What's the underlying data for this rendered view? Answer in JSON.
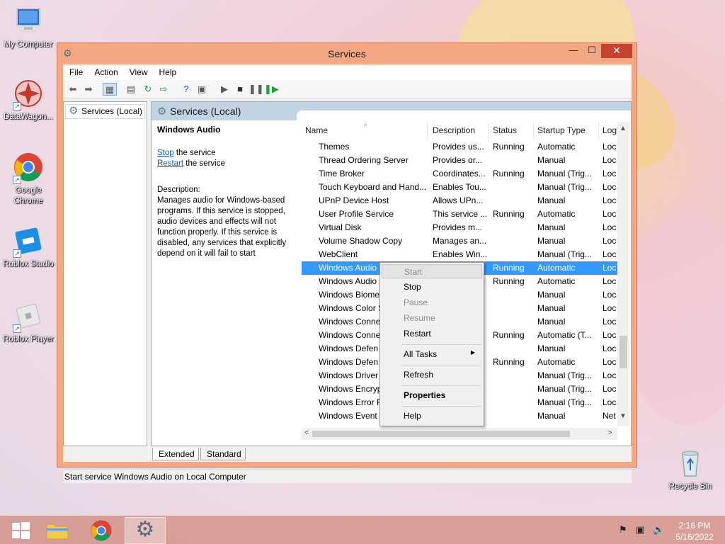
{
  "desktop": {
    "icons": [
      {
        "label": "My Computer"
      },
      {
        "label": "DataWagon..."
      },
      {
        "label": "Google Chrome"
      },
      {
        "label": "Roblox Studio"
      },
      {
        "label": "Roblox Player"
      },
      {
        "label": "Recycle Bin"
      }
    ]
  },
  "window": {
    "title": "Services",
    "min_glyph": "—",
    "max_glyph": "☐",
    "close_glyph": "✕"
  },
  "menu": {
    "file": "File",
    "action": "Action",
    "view": "View",
    "help": "Help"
  },
  "tree": {
    "item": "Services (Local)"
  },
  "main": {
    "header": "Services (Local)",
    "selected_service": "Windows Audio",
    "stop_link": "Stop",
    "stop_suffix": " the service",
    "restart_link": "Restart",
    "restart_suffix": " the service",
    "description_label": "Description:",
    "description": "Manages audio for Windows-based programs.  If this service is stopped, audio devices and effects will not function properly.  If this service is disabled, any services that explicitly depend on it will fail to start"
  },
  "columns": {
    "name": "Name",
    "description": "Description",
    "status": "Status",
    "startup": "Startup Type",
    "logon": "Log"
  },
  "rows": [
    {
      "name": "Themes",
      "description": "Provides us...",
      "status": "Running",
      "startup": "Automatic",
      "logon": "Loc"
    },
    {
      "name": "Thread Ordering Server",
      "description": "Provides or...",
      "status": "",
      "startup": "Manual",
      "logon": "Loc"
    },
    {
      "name": "Time Broker",
      "description": "Coordinates...",
      "status": "Running",
      "startup": "Manual (Trig...",
      "logon": "Loc"
    },
    {
      "name": "Touch Keyboard and Hand...",
      "description": "Enables Tou...",
      "status": "",
      "startup": "Manual (Trig...",
      "logon": "Loc"
    },
    {
      "name": "UPnP Device Host",
      "description": "Allows UPn...",
      "status": "",
      "startup": "Manual",
      "logon": "Loc"
    },
    {
      "name": "User Profile Service",
      "description": "This service ...",
      "status": "Running",
      "startup": "Automatic",
      "logon": "Loc"
    },
    {
      "name": "Virtual Disk",
      "description": "Provides m...",
      "status": "",
      "startup": "Manual",
      "logon": "Loc"
    },
    {
      "name": "Volume Shadow Copy",
      "description": "Manages an...",
      "status": "",
      "startup": "Manual",
      "logon": "Loc"
    },
    {
      "name": "WebClient",
      "description": "Enables Win...",
      "status": "",
      "startup": "Manual (Trig...",
      "logon": "Loc"
    },
    {
      "name": "Windows Audio",
      "description": "",
      "status": "Running",
      "startup": "Automatic",
      "logon": "Loc"
    },
    {
      "name": "Windows Audio",
      "description": "",
      "status": "Running",
      "startup": "Automatic",
      "logon": "Loc"
    },
    {
      "name": "Windows Biome",
      "description": "",
      "status": "",
      "startup": "Manual",
      "logon": "Loc"
    },
    {
      "name": "Windows Color S",
      "description": "",
      "status": "",
      "startup": "Manual",
      "logon": "Loc"
    },
    {
      "name": "Windows Conne",
      "description": "",
      "status": "",
      "startup": "Manual",
      "logon": "Loc"
    },
    {
      "name": "Windows Conne",
      "description": "",
      "status": "Running",
      "startup": "Automatic (T...",
      "logon": "Loc"
    },
    {
      "name": "Windows Defen",
      "description": "",
      "status": "",
      "startup": "Manual",
      "logon": "Loc"
    },
    {
      "name": "Windows Defen",
      "description": "",
      "status": "Running",
      "startup": "Automatic",
      "logon": "Loc"
    },
    {
      "name": "Windows Driver",
      "description": "",
      "status": "",
      "startup": "Manual (Trig...",
      "logon": "Loc"
    },
    {
      "name": "Windows Encryp",
      "description": "",
      "status": "",
      "startup": "Manual (Trig...",
      "logon": "Loc"
    },
    {
      "name": "Windows Error R",
      "description": "",
      "status": "",
      "startup": "Manual (Trig...",
      "logon": "Loc"
    },
    {
      "name": "Windows Event C",
      "description": "",
      "status": "",
      "startup": "Manual",
      "logon": "Net"
    }
  ],
  "tabs": {
    "extended": "Extended",
    "standard": "Standard"
  },
  "status_bar": "Start service Windows Audio on Local Computer",
  "context_menu": {
    "start": "Start",
    "stop": "Stop",
    "pause": "Pause",
    "resume": "Resume",
    "restart": "Restart",
    "all_tasks": "All Tasks",
    "refresh": "Refresh",
    "properties": "Properties",
    "help": "Help"
  },
  "taskbar": {
    "time": "2:16 PM",
    "date": "5/16/2022"
  },
  "colors": {
    "selection": "#3399ff",
    "title_bar": "#f3a782",
    "close_button": "#c7422f"
  }
}
